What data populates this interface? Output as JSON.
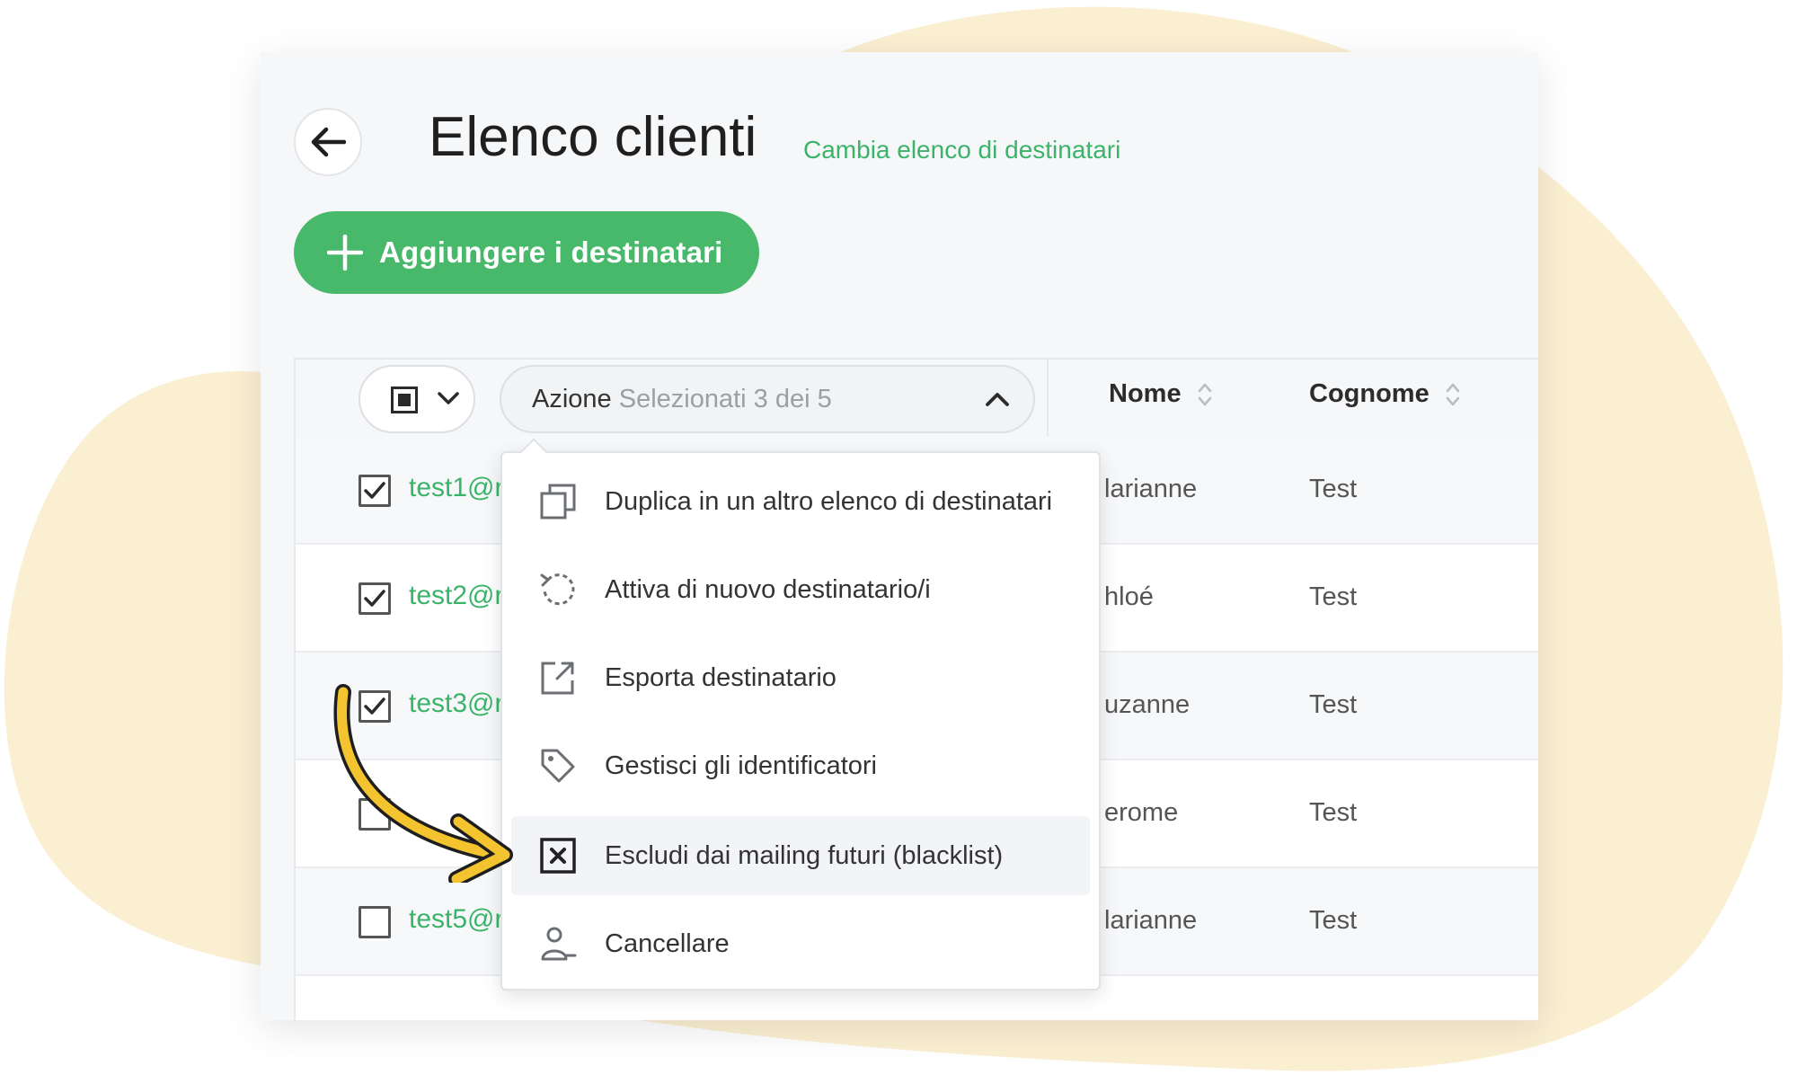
{
  "colors": {
    "accent_green": "#48b86a",
    "link_green": "#3bb46a",
    "blob": "#fbefd2",
    "arrow": "#f4c430"
  },
  "header": {
    "back_icon": "arrow-left-icon",
    "title": "Elenco clienti",
    "change_list_link": "Cambia elenco di destinatari"
  },
  "add_button": {
    "icon": "plus-icon",
    "label": "Aggiungere i destinatari"
  },
  "table": {
    "action_label": "Azione",
    "selection_status": "Selezionati 3 dei 5",
    "columns": [
      "Nome",
      "Cognome"
    ],
    "rows": [
      {
        "checked": true,
        "email": "test1@r",
        "first_name": "larianne",
        "last_name": "Test"
      },
      {
        "checked": true,
        "email": "test2@r",
        "first_name": "hloé",
        "last_name": "Test"
      },
      {
        "checked": true,
        "email": "test3@r",
        "first_name": "uzanne",
        "last_name": "Test"
      },
      {
        "checked": false,
        "email": "",
        "first_name": "erome",
        "last_name": "Test"
      },
      {
        "checked": false,
        "email": "test5@r",
        "first_name": "larianne",
        "last_name": "Test"
      }
    ]
  },
  "action_menu": {
    "items": [
      {
        "icon": "duplicate-icon",
        "label": "Duplica in un altro elenco di destinatari"
      },
      {
        "icon": "reactivate-icon",
        "label": "Attiva di nuovo destinatario/i"
      },
      {
        "icon": "export-icon",
        "label": "Esporta destinatario"
      },
      {
        "icon": "tag-icon",
        "label": "Gestisci gli identificatori"
      },
      {
        "icon": "blacklist-icon",
        "label": "Escludi dai mailing futuri (blacklist)",
        "highlighted": true
      },
      {
        "icon": "delete-user-icon",
        "label": "Cancellare"
      }
    ]
  }
}
